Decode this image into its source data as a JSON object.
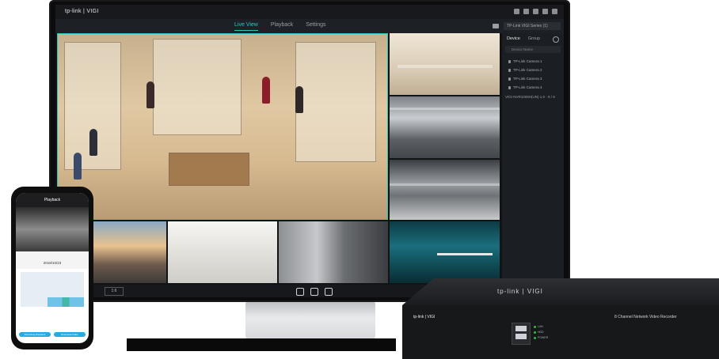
{
  "app": {
    "logo": "tp-link | VIGI"
  },
  "nav": {
    "tabs": [
      {
        "label": "Live View",
        "active": true
      },
      {
        "label": "Playback",
        "active": false
      },
      {
        "label": "Settings",
        "active": false
      }
    ],
    "site_select": "TP-Link VIGI Series (1)"
  },
  "sidebar": {
    "tabs": [
      {
        "label": "Device",
        "active": true
      },
      {
        "label": "Group",
        "active": false
      }
    ],
    "search_placeholder": "Device Name",
    "devices": [
      "TP-Link Camera 1",
      "TP-Link Camera 2",
      "TP-Link Camera 3",
      "TP-Link Camera 4"
    ],
    "nvr_row": "VIGI NVR1008H(UN) 1.0 · 8 / 8"
  },
  "bottom_bar": {
    "layout_label": "1:6"
  },
  "phone": {
    "title": "Playback",
    "date": "2018/10/23",
    "buttons": [
      "Recording Playback",
      "Download Video"
    ]
  },
  "nvr": {
    "top_logo": "tp-link | VIGI",
    "front_logo": "tp-link | VIGI",
    "label": "8 Channel Network Video Recorder",
    "leds": [
      "LAN",
      "HDD",
      "POWER"
    ]
  },
  "colors": {
    "accent": "#2fc5c0",
    "background": "#111315"
  },
  "icons": [
    "window-icons",
    "folder-icon",
    "refresh-icon",
    "camera-icon",
    "snapshot-icon",
    "record-icon",
    "zoom-icon"
  ]
}
